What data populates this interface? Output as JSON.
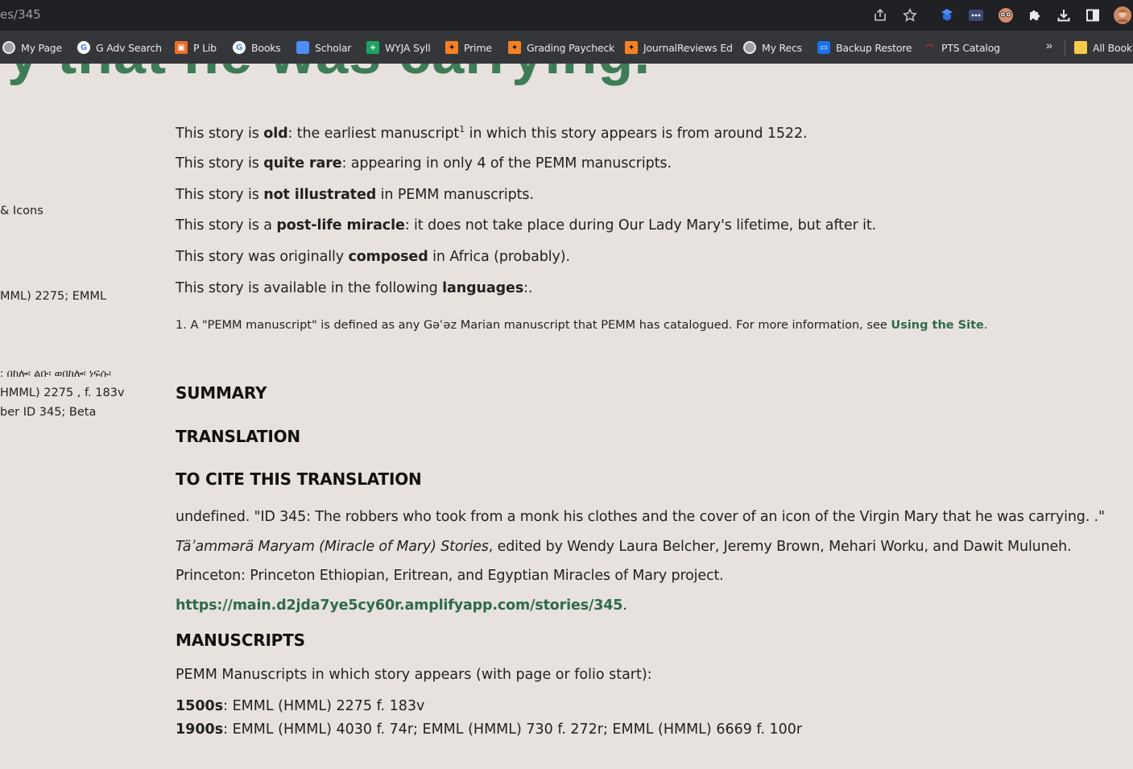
{
  "browser": {
    "url_fragment": "es/345",
    "toolbar_icons": [
      "share-icon",
      "star-icon",
      "extension-blue-icon",
      "extension-dots-icon",
      "extension-face-icon",
      "puzzle-icon",
      "download-icon",
      "sidebar-icon",
      "profile-avatar"
    ],
    "bookmarks": [
      {
        "label": "My Page",
        "icon": "globe-icon"
      },
      {
        "label": "G Adv Search",
        "icon": "google-icon"
      },
      {
        "label": "P Lib",
        "icon": "library-icon"
      },
      {
        "label": "Books",
        "icon": "google-icon"
      },
      {
        "label": "Scholar",
        "icon": "scholar-icon"
      },
      {
        "label": "WYJA Syll",
        "icon": "sheets-icon"
      },
      {
        "label": "Prime",
        "icon": "princeton-icon"
      },
      {
        "label": "Grading Paycheck",
        "icon": "princeton-icon"
      },
      {
        "label": "JournalReviews Ed",
        "icon": "princeton-icon"
      },
      {
        "label": "My Recs",
        "icon": "globe-icon"
      },
      {
        "label": "Backup Restore",
        "icon": "backup-icon"
      },
      {
        "label": "PTS Catalog",
        "icon": "pts-icon"
      }
    ],
    "overflow_label": "»",
    "all_bookmarks_label": "All Book"
  },
  "page": {
    "title_fragment": "ry that he was carrying.",
    "sidebar_fragments": [
      "& Icons",
      "MML) 2275; EMML",
      ": በከሎ፡ ልቡ፡ ወበከሎ፡ ነፍሱ፡",
      "HMML) 2275 , f. 183v",
      "ber ID 345; Beta"
    ],
    "facts": [
      {
        "pre": "This story is ",
        "bold": "old",
        "post_a": ": the earliest manuscript",
        "sup": "1",
        "post": " in which this story appears is from around 1522."
      },
      {
        "pre": "This story is ",
        "bold": "quite rare",
        "post": ": appearing in only 4 of the PEMM manuscripts."
      },
      {
        "pre": "This story is ",
        "bold": "not illustrated",
        "post": " in PEMM manuscripts."
      },
      {
        "pre": "This story is a ",
        "bold": "post-life miracle",
        "post": ": it does not take place during Our Lady Mary's lifetime, but after it."
      },
      {
        "pre": "This story was originally ",
        "bold": "composed",
        "post": " in Africa (probably)."
      },
      {
        "pre": "This story is available in the following ",
        "bold": "languages",
        "post": ":."
      }
    ],
    "footnote": {
      "text": "1. A \"PEMM manuscript\" is defined as any Gəʿəz Marian manuscript that PEMM has catalogued. For more information, see ",
      "link": "Using the Site",
      "end": "."
    },
    "headings": {
      "summary": "SUMMARY",
      "translation": "TRANSLATION",
      "cite": "TO CITE THIS TRANSLATION",
      "manuscripts": "MANUSCRIPTS"
    },
    "citation": {
      "text1": "undefined. \"ID 345: The robbers who took from a monk his clothes and the cover of an icon of the Virgin Mary that he was carrying. .\" ",
      "italic": "Täʾammərä Maryam (Miracle of Mary) Stories",
      "text2": ", edited by Wendy Laura Belcher, Jeremy Brown, Mehari Worku, and Dawit Muluneh. Princeton: Princeton Ethiopian, Eritrean, and Egyptian Miracles of Mary project. ",
      "link": "https://main.d2jda7ye5cy60r.amplifyapp.com/stories/345",
      "end": "."
    },
    "manuscripts": {
      "intro": "PEMM Manuscripts in which story appears (with page or folio start):",
      "rows": [
        {
          "century": "1500s",
          "list": ": EMML (HMML) 2275 f. 183v"
        },
        {
          "century": "1900s",
          "list": ": EMML (HMML) 4030 f. 74r; EMML (HMML) 730 f. 272r; EMML (HMML) 6669 f. 100r"
        }
      ]
    }
  }
}
